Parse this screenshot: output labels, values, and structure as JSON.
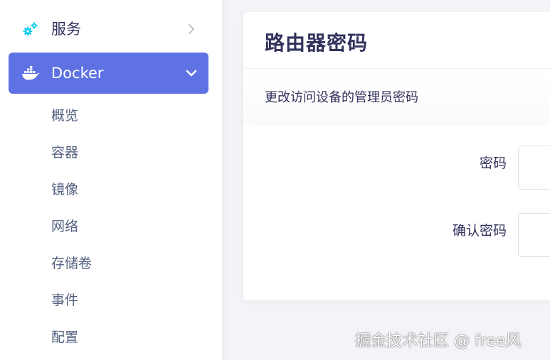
{
  "sidebar": {
    "services": {
      "label": "服务",
      "icon": "gears-icon",
      "icon_color": "#11cdef"
    },
    "docker": {
      "label": "Docker",
      "icon": "docker-whale-icon",
      "active_color": "#5e72e4"
    },
    "docker_children": [
      {
        "label": "概览"
      },
      {
        "label": "容器"
      },
      {
        "label": "镜像"
      },
      {
        "label": "网络"
      },
      {
        "label": "存储卷"
      },
      {
        "label": "事件"
      },
      {
        "label": "配置"
      }
    ]
  },
  "card": {
    "title": "路由器密码",
    "description": "更改访问设备的管理员密码",
    "fields": [
      {
        "label": "密码",
        "value": ""
      },
      {
        "label": "确认密码",
        "value": ""
      }
    ]
  },
  "watermark": {
    "text": "掘金技术社区 @ free风"
  }
}
